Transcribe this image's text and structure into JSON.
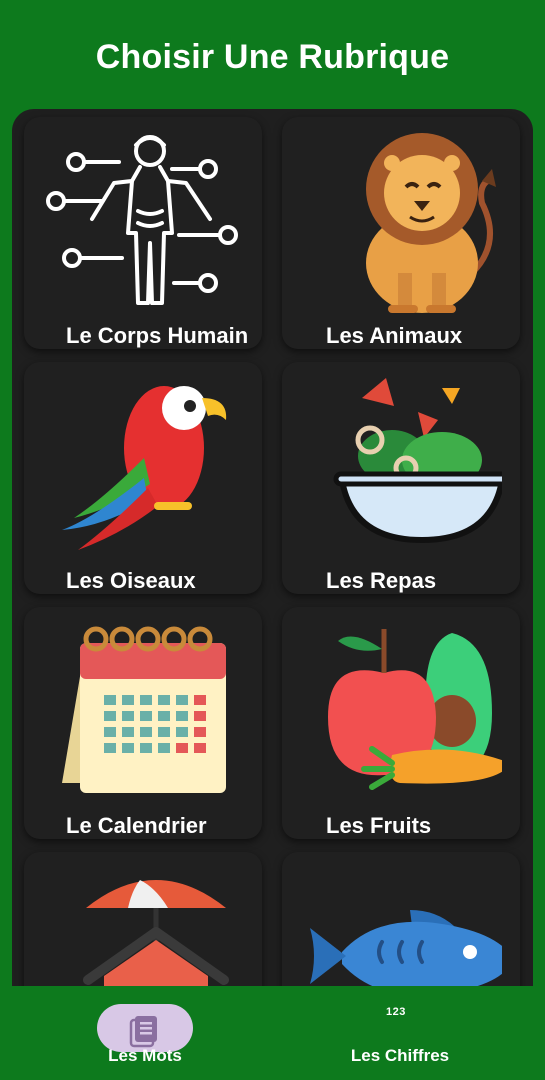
{
  "header": {
    "title": "Choisir Une Rubrique"
  },
  "categories": [
    {
      "label": "Le Corps Humain",
      "icon": "human-body-icon"
    },
    {
      "label": "Les Animaux",
      "icon": "lion-icon"
    },
    {
      "label": "Les Oiseaux",
      "icon": "parrot-icon"
    },
    {
      "label": "Les Repas",
      "icon": "salad-bowl-icon"
    },
    {
      "label": "Le Calendrier",
      "icon": "calendar-icon"
    },
    {
      "label": "Les Fruits",
      "icon": "fruits-vegetables-icon"
    },
    {
      "label": "",
      "icon": "house-umbrella-icon"
    },
    {
      "label": "",
      "icon": "fish-icon"
    }
  ],
  "bottom_nav": {
    "items": [
      {
        "label": "Les Mots",
        "icon": "book-list-icon",
        "selected": true
      },
      {
        "label": "Les Chiffres",
        "icon_text": "123",
        "icon": "numbers-icon",
        "selected": false
      }
    ]
  },
  "colors": {
    "brand_green": "#0d7a1d",
    "panel": "#1f1f1f",
    "selected_pill": "#d8c8e6"
  }
}
